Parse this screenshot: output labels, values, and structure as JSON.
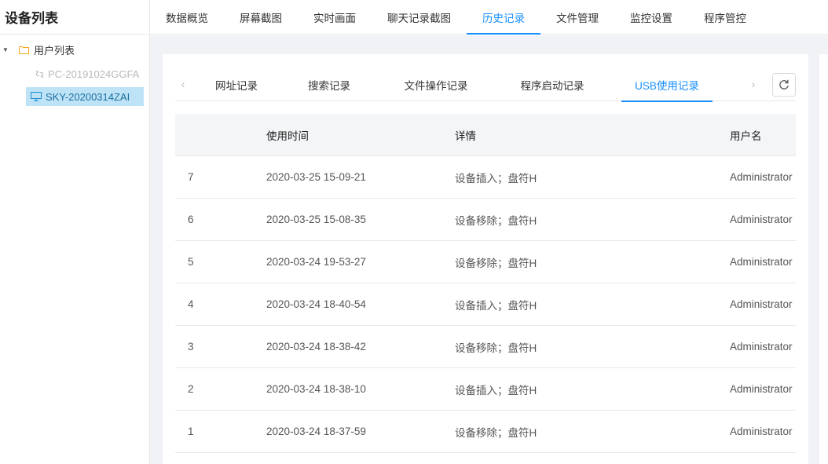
{
  "sidebar": {
    "title": "设备列表",
    "root_label": "用户列表",
    "devices": [
      {
        "name": "PC-20191024GGFA",
        "status": "offline"
      },
      {
        "name": "SKY-20200314ZAI",
        "status": "online"
      }
    ]
  },
  "topnav": {
    "items": [
      "数据概览",
      "屏幕截图",
      "实时画面",
      "聊天记录截图",
      "历史记录",
      "文件管理",
      "监控设置",
      "程序管控"
    ],
    "active": "历史记录"
  },
  "subtabs": {
    "items": [
      "网址记录",
      "搜索记录",
      "文件操作记录",
      "程序启动记录",
      "USB使用记录"
    ],
    "active": "USB使用记录",
    "prev_glyph": "‹",
    "next_glyph": "›"
  },
  "table": {
    "headers": {
      "index": "",
      "time": "使用时间",
      "detail": "详情",
      "user": "用户名"
    },
    "rows": [
      {
        "index": "7",
        "time": "2020-03-25 15-09-21",
        "detail": "设备插入；盘符H",
        "user": "Administrator"
      },
      {
        "index": "6",
        "time": "2020-03-25 15-08-35",
        "detail": "设备移除；盘符H",
        "user": "Administrator"
      },
      {
        "index": "5",
        "time": "2020-03-24 19-53-27",
        "detail": "设备移除；盘符H",
        "user": "Administrator"
      },
      {
        "index": "4",
        "time": "2020-03-24 18-40-54",
        "detail": "设备插入；盘符H",
        "user": "Administrator"
      },
      {
        "index": "3",
        "time": "2020-03-24 18-38-42",
        "detail": "设备移除；盘符H",
        "user": "Administrator"
      },
      {
        "index": "2",
        "time": "2020-03-24 18-38-10",
        "detail": "设备插入；盘符H",
        "user": "Administrator"
      },
      {
        "index": "1",
        "time": "2020-03-24 18-37-59",
        "detail": "设备移除；盘符H",
        "user": "Administrator"
      }
    ]
  },
  "colors": {
    "accent": "#1890ff",
    "selected_bg": "#bfe3f6",
    "content_bg": "#f0f2f5"
  },
  "icons": {
    "folder": "folder-icon",
    "offline": "unlink-icon",
    "online": "monitor-icon",
    "refresh": "refresh-icon",
    "caret": "caret-down-icon"
  }
}
